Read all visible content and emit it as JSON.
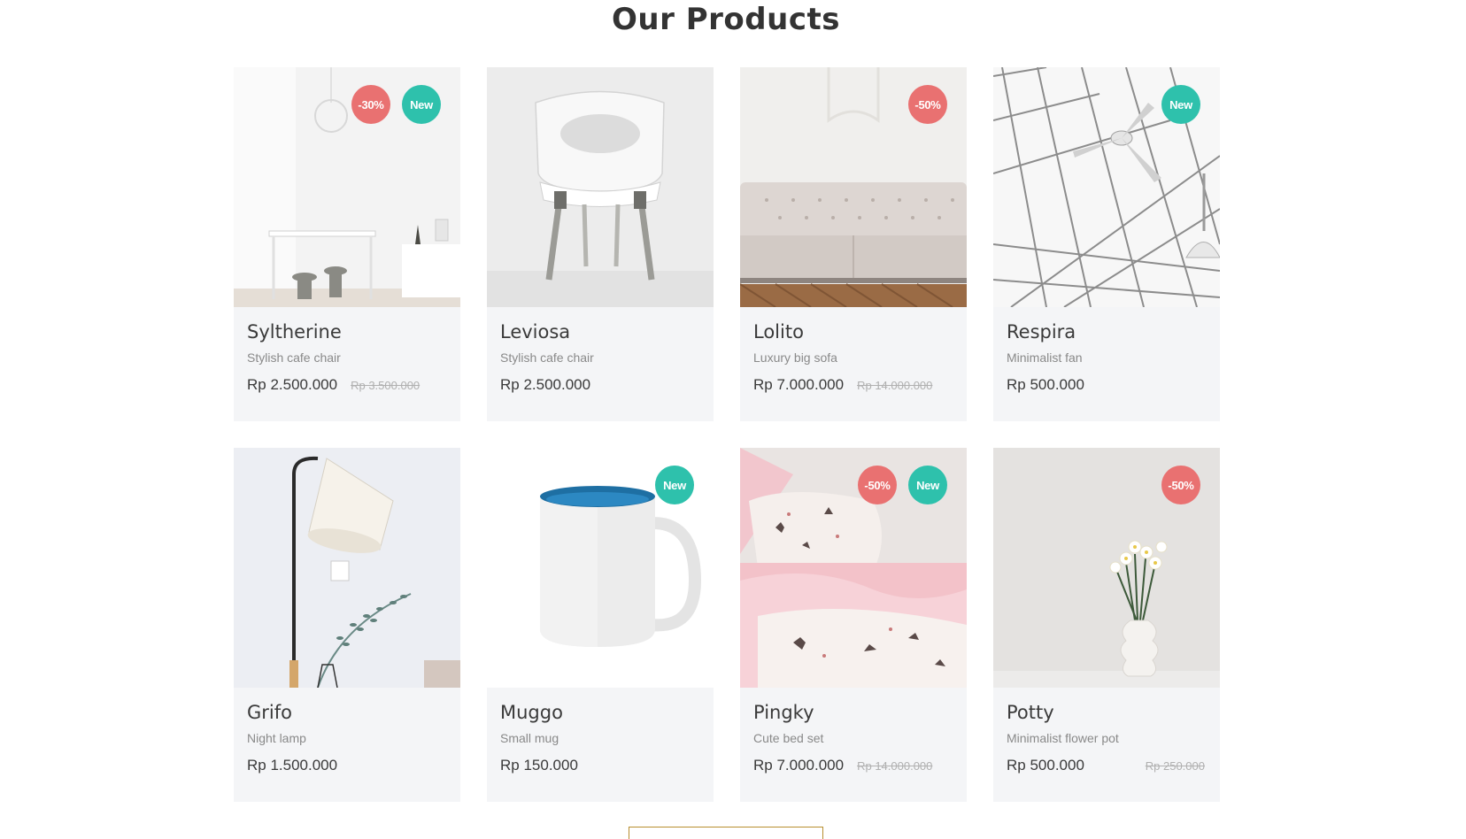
{
  "section": {
    "title": "Our Products"
  },
  "colors": {
    "discount_badge": "#e97171",
    "new_badge": "#2ec1ac",
    "card_bg": "#f4f5f7",
    "accent_border": "#b88e2f"
  },
  "products": [
    {
      "name": "Syltherine",
      "description": "Stylish cafe chair",
      "price": "Rp 2.500.000",
      "old_price": "Rp 3.500.000",
      "discount": "-30%",
      "new": "New",
      "image": "room-table-image"
    },
    {
      "name": "Leviosa",
      "description": "Stylish cafe chair",
      "price": "Rp 2.500.000",
      "old_price": "",
      "discount": "",
      "new": "",
      "image": "white-chair-image"
    },
    {
      "name": "Lolito",
      "description": "Luxury big sofa",
      "price": "Rp 7.000.000",
      "old_price": "Rp 14.000.000",
      "discount": "-50%",
      "new": "",
      "image": "sofa-image"
    },
    {
      "name": "Respira",
      "description": "Minimalist fan",
      "price": "Rp 500.000",
      "old_price": "",
      "discount": "",
      "new": "New",
      "image": "ceiling-fan-image"
    },
    {
      "name": "Grifo",
      "description": "Night lamp",
      "price": "Rp 1.500.000",
      "old_price": "",
      "discount": "",
      "new": "",
      "image": "floor-lamp-image"
    },
    {
      "name": "Muggo",
      "description": "Small mug",
      "price": "Rp 150.000",
      "old_price": "",
      "discount": "",
      "new": "New",
      "image": "mug-image"
    },
    {
      "name": "Pingky",
      "description": "Cute bed set",
      "price": "Rp 7.000.000",
      "old_price": "Rp 14.000.000",
      "discount": "-50%",
      "new": "New",
      "image": "bed-set-image"
    },
    {
      "name": "Potty",
      "description": "Minimalist flower pot",
      "price": "Rp 500.000",
      "old_price": "Rp 250.000",
      "discount": "-50%",
      "new": "",
      "image": "flower-pot-image"
    }
  ]
}
